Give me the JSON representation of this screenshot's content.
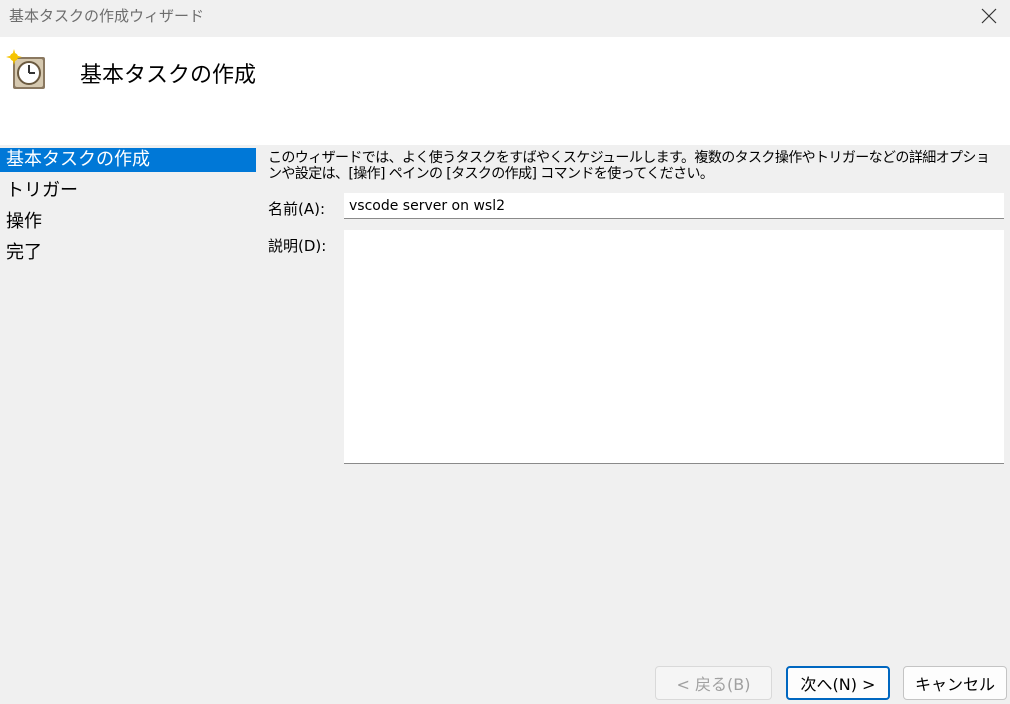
{
  "window": {
    "title": "基本タスクの作成ウィザード",
    "close_icon": "close-icon"
  },
  "header": {
    "title": "基本タスクの作成",
    "icon": "task-scheduler-clock-icon"
  },
  "sidebar": {
    "items": [
      {
        "label": "基本タスクの作成",
        "active": true
      },
      {
        "label": "トリガー",
        "active": false
      },
      {
        "label": "操作",
        "active": false
      },
      {
        "label": "完了",
        "active": false
      }
    ]
  },
  "content": {
    "description": "このウィザードでは、よく使うタスクをすばやくスケジュールします。複数のタスク操作やトリガーなどの詳細オプションや設定は、[操作] ペインの [タスクの作成] コマンドを使ってください。",
    "name_label": "名前(A):",
    "name_value": "vscode server on wsl2",
    "desc_label": "説明(D):",
    "desc_value": ""
  },
  "buttons": {
    "back": "< 戻る(B)",
    "next": "次へ(N) >",
    "cancel": "キャンセル"
  },
  "colors": {
    "accent": "#0078d7",
    "next_border": "#0067c0"
  }
}
